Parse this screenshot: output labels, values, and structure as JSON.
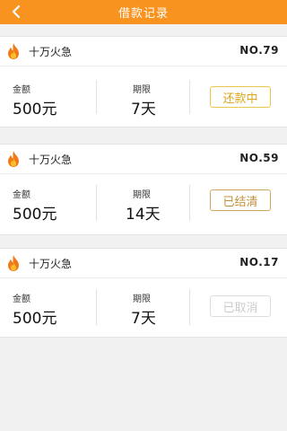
{
  "header": {
    "title": "借款记录"
  },
  "icons": {
    "back": "chevron-left-icon",
    "product": "fire-icon"
  },
  "colors": {
    "header_bg": "#f7931e",
    "status_active": "#dca71c",
    "status_done": "#c0923c",
    "status_cancel": "#cccccc"
  },
  "labels": {
    "amount": "金额",
    "term": "期限"
  },
  "records": [
    {
      "product": "十万火急",
      "number": "NO.79",
      "amount": "500元",
      "term": "7天",
      "status": "还款中"
    },
    {
      "product": "十万火急",
      "number": "NO.59",
      "amount": "500元",
      "term": "14天",
      "status": "已结清"
    },
    {
      "product": "十万火急",
      "number": "NO.17",
      "amount": "500元",
      "term": "7天",
      "status": "已取消"
    }
  ]
}
